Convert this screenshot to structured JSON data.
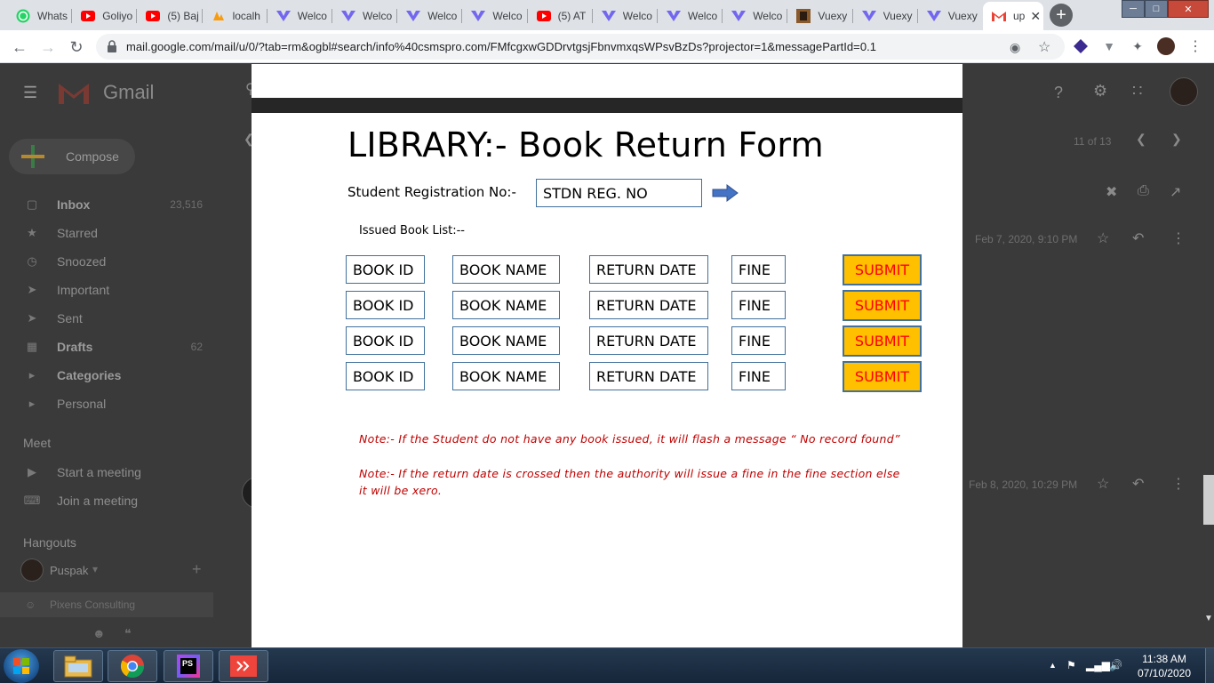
{
  "browser": {
    "tabs": [
      {
        "label": "Whats",
        "icon": "whatsapp-icon",
        "color": "#25d366"
      },
      {
        "label": "Goliyo",
        "icon": "youtube-icon",
        "color": "#ff0000"
      },
      {
        "label": "(5) Baj",
        "icon": "youtube-icon",
        "color": "#ff0000"
      },
      {
        "label": "localh",
        "icon": "phpmyadmin-icon",
        "color": "#f89c0e"
      },
      {
        "label": "Welco",
        "icon": "vuexy-icon",
        "color": "#7367f0"
      },
      {
        "label": "Welco",
        "icon": "vuexy-icon",
        "color": "#7367f0"
      },
      {
        "label": "Welco",
        "icon": "vuexy-icon",
        "color": "#7367f0"
      },
      {
        "label": "Welco",
        "icon": "vuexy-icon",
        "color": "#7367f0"
      },
      {
        "label": "(5) AT",
        "icon": "youtube-icon",
        "color": "#ff0000"
      },
      {
        "label": "Welco",
        "icon": "vuexy-icon",
        "color": "#7367f0"
      },
      {
        "label": "Welco",
        "icon": "vuexy-icon",
        "color": "#7367f0"
      },
      {
        "label": "Welco",
        "icon": "vuexy-icon",
        "color": "#7367f0"
      },
      {
        "label": "Vuexy",
        "icon": "theme-icon",
        "color": "#8a5a2b"
      },
      {
        "label": "Vuexy",
        "icon": "vuexy-icon",
        "color": "#7367f0"
      },
      {
        "label": "Vuexy",
        "icon": "vuexy-icon",
        "color": "#7367f0"
      }
    ],
    "active_tab": {
      "label": "up",
      "icon": "gmail-icon"
    },
    "url": "mail.google.com/mail/u/0/?tab=rm&ogbl#search/info%40csmspro.com/FMfcgxwGDDrvtgsjFbnvmxqsWPsvBzDs?projector=1&messagePartId=0.1"
  },
  "gmail": {
    "logo_text": "Gmail",
    "compose_label": "Compose",
    "nav": [
      {
        "label": "Inbox",
        "count": "23,516",
        "icon": "inbox-icon",
        "bold": true
      },
      {
        "label": "Starred",
        "count": "",
        "icon": "star-icon",
        "bold": false
      },
      {
        "label": "Snoozed",
        "count": "",
        "icon": "clock-icon",
        "bold": false
      },
      {
        "label": "Important",
        "count": "",
        "icon": "important-icon",
        "bold": false
      },
      {
        "label": "Sent",
        "count": "",
        "icon": "send-icon",
        "bold": false
      },
      {
        "label": "Drafts",
        "count": "62",
        "icon": "draft-icon",
        "bold": true
      },
      {
        "label": "Categories",
        "count": "",
        "icon": "label-icon",
        "bold": true
      },
      {
        "label": "Personal",
        "count": "",
        "icon": "label-icon",
        "bold": false
      }
    ],
    "meet": {
      "title": "Meet",
      "start": "Start a meeting",
      "join": "Join a meeting"
    },
    "hangouts": {
      "title": "Hangouts",
      "user": "Puspak",
      "contact": "Pixens Consulting"
    },
    "pager": "11 of 13",
    "date1": "Feb 7, 2020, 9:10 PM",
    "date2": "Feb 8, 2020, 10:29 PM"
  },
  "form": {
    "title": "LIBRARY:- Book Return Form",
    "reg_label": "Student Registration No:-",
    "reg_value": "STDN REG. NO",
    "issued_label": "Issued Book List:--",
    "columns": [
      "BOOK ID",
      "BOOK NAME",
      "RETURN DATE",
      "FINE"
    ],
    "rows": [
      {
        "book_id": "BOOK ID",
        "book_name": "BOOK NAME",
        "return_date": "RETURN DATE",
        "fine": "FINE",
        "action": "SUBMIT"
      },
      {
        "book_id": "BOOK ID",
        "book_name": "BOOK NAME",
        "return_date": "RETURN DATE",
        "fine": "FINE",
        "action": "SUBMIT"
      },
      {
        "book_id": "BOOK ID",
        "book_name": "BOOK NAME",
        "return_date": "RETURN DATE",
        "fine": "FINE",
        "action": "SUBMIT"
      },
      {
        "book_id": "BOOK ID",
        "book_name": "BOOK NAME",
        "return_date": "RETURN DATE",
        "fine": "FINE",
        "action": "SUBMIT"
      }
    ],
    "note1": "Note:- If the Student do not have any book issued, it will flash a message “ No record found”",
    "note2": "Note:- If the return date is crossed then the authority will issue a fine in the fine section else it will be xero.",
    "colors": {
      "submit_bg": "#ffc000",
      "submit_text": "#ff0000",
      "border": "#41719c",
      "note": "#c00000"
    }
  },
  "taskbar": {
    "apps": [
      "explorer-icon",
      "chrome-icon",
      "phpstorm-icon",
      "anydesk-icon"
    ],
    "phpstorm_label": "PS",
    "time": "11:38 AM",
    "date": "07/10/2020"
  }
}
